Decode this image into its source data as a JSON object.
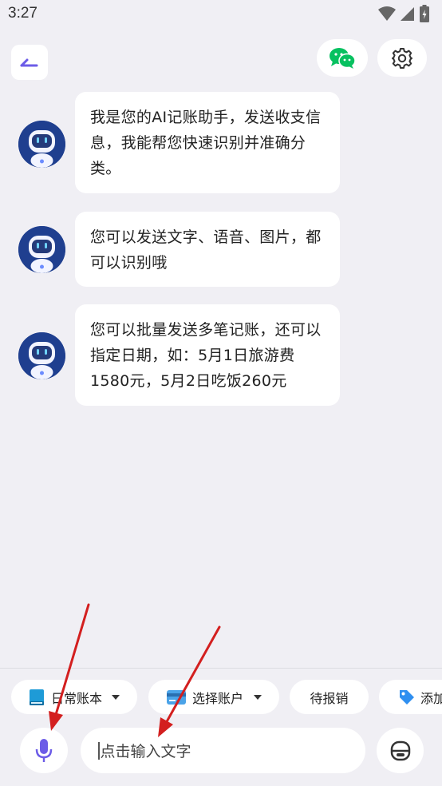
{
  "status_bar": {
    "time": "3:27"
  },
  "header": {
    "back_icon": "back-arrow-icon",
    "wechat_icon": "wechat-icon",
    "settings_icon": "gear-icon"
  },
  "messages": [
    {
      "sender": "ai-assistant",
      "avatar_icon": "robot-avatar-icon",
      "text": "我是您的AI记账助手，发送收支信息，我能帮您快速识别并准确分类。"
    },
    {
      "sender": "ai-assistant",
      "avatar_icon": "robot-avatar-icon",
      "text": "您可以发送文字、语音、图片，都可以识别哦"
    },
    {
      "sender": "ai-assistant",
      "avatar_icon": "robot-avatar-icon",
      "text": "您可以批量发送多笔记账，还可以指定日期，如：5月1日旅游费1580元，5月2日吃饭260元"
    }
  ],
  "quick_chips": [
    {
      "label": "日常账本",
      "icon": "book-icon",
      "dropdown": true
    },
    {
      "label": "选择账户",
      "icon": "credit-card-icon",
      "dropdown": true
    },
    {
      "label": "待报销",
      "icon": "",
      "dropdown": false
    },
    {
      "label": "添加",
      "icon": "tag-icon",
      "dropdown": false
    }
  ],
  "input": {
    "placeholder": "点击输入文字",
    "mic_icon": "microphone-icon",
    "bot_icon": "robot-face-icon"
  },
  "colors": {
    "background": "#f0eff4",
    "accent": "#6c5ce7",
    "wechat_green": "#07c160",
    "annotation_arrow": "#d31f1f"
  }
}
